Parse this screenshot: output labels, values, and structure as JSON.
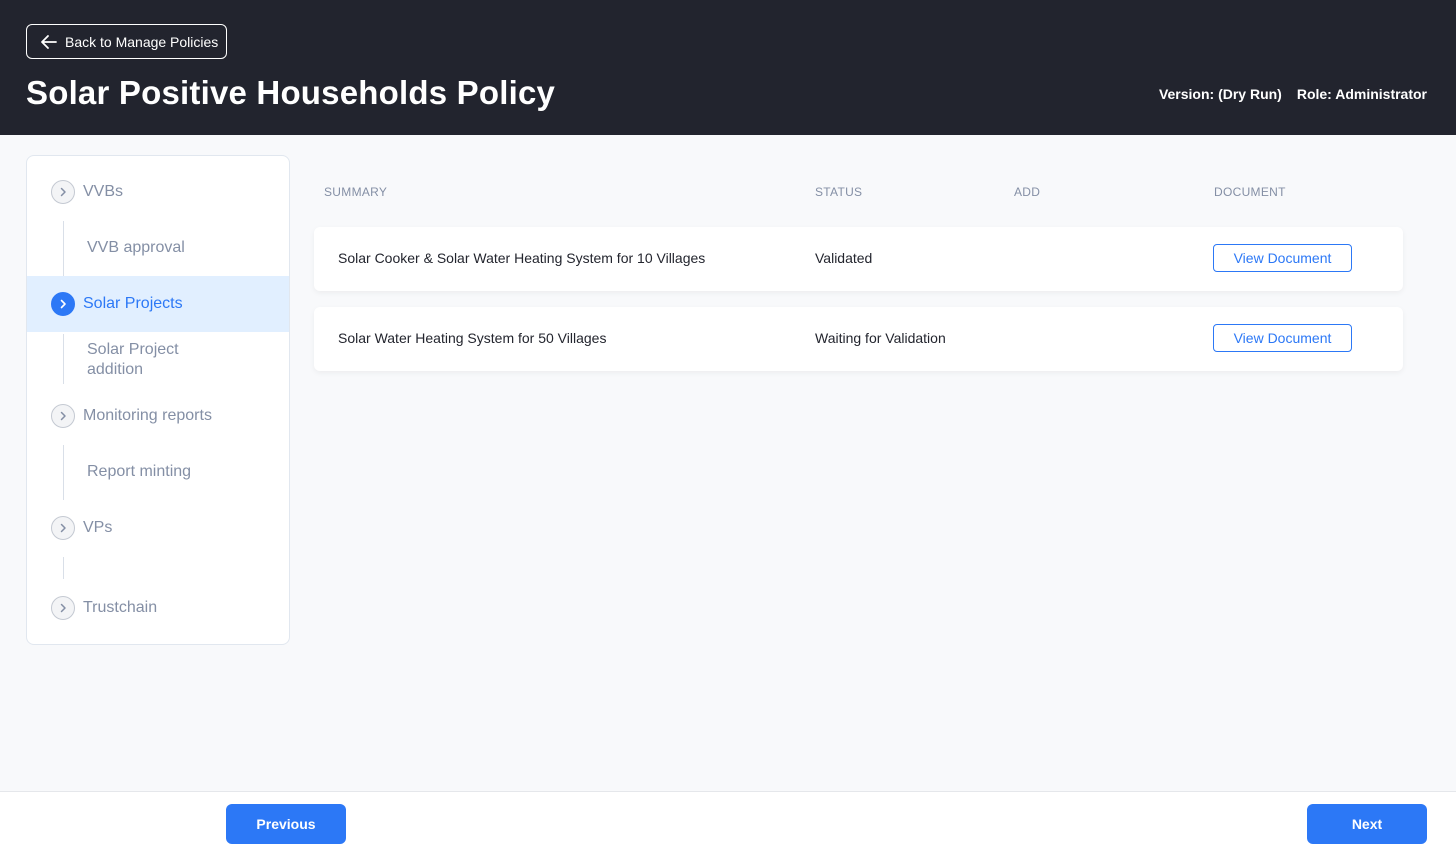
{
  "header": {
    "back_label": "Back to Manage Policies",
    "title": "Solar Positive Households Policy",
    "version": "Version: (Dry Run)",
    "role": "Role: Administrator"
  },
  "sidebar": {
    "items": [
      {
        "label": "VVBs",
        "sub": "VVB approval"
      },
      {
        "label": "Solar Projects",
        "sub": "Solar Project addition",
        "active": true
      },
      {
        "label": "Monitoring reports",
        "sub": "Report minting"
      },
      {
        "label": "VPs",
        "sub": ""
      },
      {
        "label": "Trustchain"
      }
    ]
  },
  "table": {
    "columns": [
      "SUMMARY",
      "STATUS",
      "ADD",
      "DOCUMENT"
    ],
    "rows": [
      {
        "summary": "Solar Cooker & Solar Water Heating System for 10 Villages",
        "status": "Validated",
        "add": "",
        "document": "View Document"
      },
      {
        "summary": "Solar Water Heating System for 50 Villages",
        "status": "Waiting for Validation",
        "add": "",
        "document": "View Document"
      }
    ]
  },
  "footer": {
    "previous_label": "Previous",
    "next_label": "Next"
  },
  "colors": {
    "header_bg": "#22242e",
    "accent": "#2c78f6",
    "active_bg": "#e1efff",
    "muted_text": "#848fa5"
  },
  "icons": {
    "back": "arrow-left-icon",
    "nav": "chevron-right-icon"
  }
}
